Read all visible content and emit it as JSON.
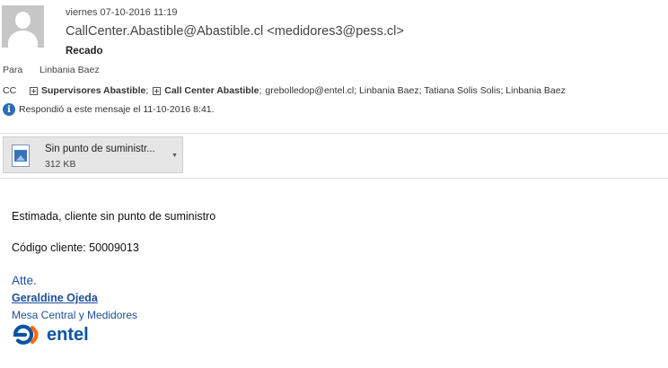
{
  "header": {
    "date": "viernes 07-10-2016 11:19",
    "from": "CallCenter.Abastible@Abastible.cl <medidores3@pess.cl>",
    "subject": "Recado"
  },
  "to": {
    "label": "Para",
    "value": "Linbania Baez"
  },
  "cc": {
    "label": "CC",
    "groups": [
      "Supervisores Abastible",
      "Call Center Abastible"
    ],
    "sep1": ";",
    "sep2": ";",
    "others": "grebolledop@entel.cl; Linbania Baez; Tatiana Solis Solis; Linbania Baez"
  },
  "info": {
    "text": "Respondió a este mensaje el 11-10-2016 8:41."
  },
  "attachment": {
    "name": "Sin punto de suministr...",
    "size": "312 KB"
  },
  "body": {
    "line1": "Estimada, cliente sin punto de suministro",
    "line2": "Código cliente: 50009013"
  },
  "signature": {
    "closing": "Atte.",
    "name": "Geraldine Ojeda",
    "department": "Mesa Central y Medidores",
    "logo_text": "entel",
    "brand_orange": "#ff6a13",
    "brand_blue": "#0a54a5"
  }
}
